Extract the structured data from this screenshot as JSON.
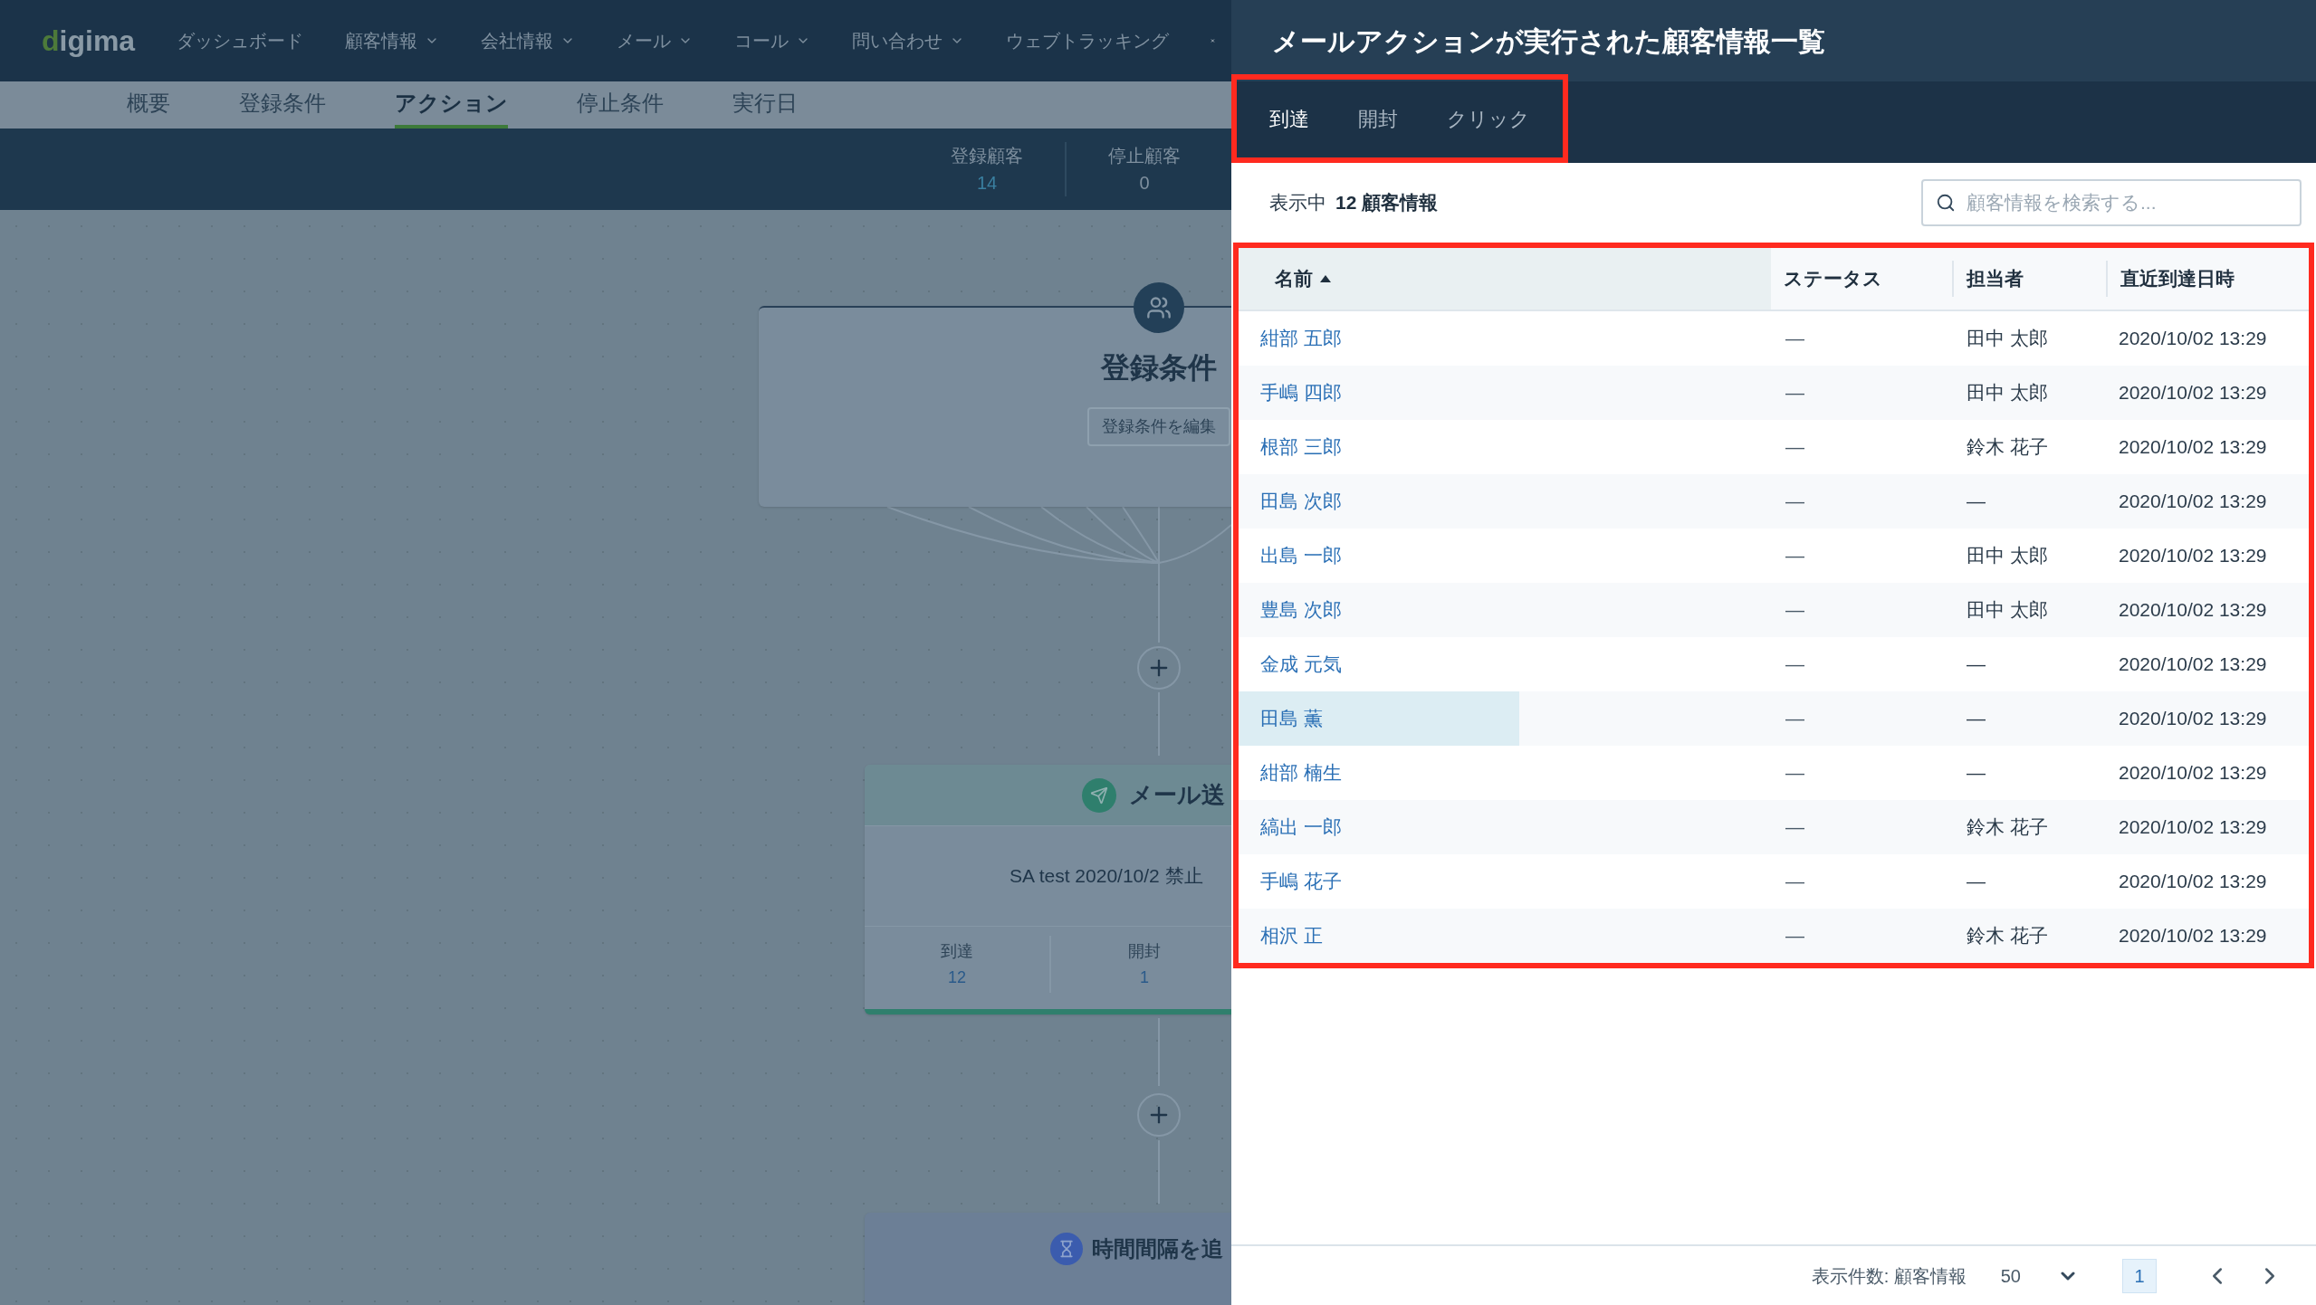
{
  "nav": {
    "logo": "digima",
    "items": [
      {
        "label": "ダッシュボード",
        "dropdown": false
      },
      {
        "label": "顧客情報",
        "dropdown": true
      },
      {
        "label": "会社情報",
        "dropdown": true
      },
      {
        "label": "メール",
        "dropdown": true
      },
      {
        "label": "コール",
        "dropdown": true
      },
      {
        "label": "問い合わせ",
        "dropdown": true
      },
      {
        "label": "ウェブトラッキング",
        "dropdown": false
      }
    ]
  },
  "sub_tabs": [
    {
      "label": "概要",
      "selected": false
    },
    {
      "label": "登録条件",
      "selected": false
    },
    {
      "label": "アクション",
      "selected": true
    },
    {
      "label": "停止条件",
      "selected": false
    },
    {
      "label": "実行日",
      "selected": false
    }
  ],
  "stats": [
    {
      "label": "登録顧客",
      "value": "14",
      "link": true
    },
    {
      "label": "停止顧客",
      "value": "0",
      "link": false
    }
  ],
  "canvas": {
    "entry_node": {
      "title": "登録条件",
      "button": "登録条件を編集"
    },
    "mail_node": {
      "title": "メール送",
      "subject": "SA test 2020/10/2 禁止",
      "stats": [
        {
          "label": "到達",
          "value": "12"
        },
        {
          "label": "開封",
          "value": "1"
        }
      ]
    },
    "wait_node": {
      "title": "時間間隔を追"
    }
  },
  "panel": {
    "title": "メールアクションが実行された顧客情報一覧",
    "tab_bar": {
      "outlined": true,
      "tabs": [
        {
          "label": "到達",
          "selected": true
        },
        {
          "label": "開封",
          "selected": false
        },
        {
          "label": "クリック",
          "selected": false
        }
      ]
    },
    "count_label": "表示中",
    "count": "12 顧客情報",
    "search": {
      "placeholder": "顧客情報を検索する..."
    },
    "table": {
      "outlined": true,
      "columns": [
        {
          "label": "名前",
          "sorted": true
        },
        {
          "label": "ステータス",
          "sorted": false
        },
        {
          "label": "担当者",
          "sorted": false
        },
        {
          "label": "直近到達日時",
          "sorted": false
        }
      ],
      "rows": [
        {
          "name": "紺部 五郎",
          "status": "—",
          "owner": "田中 太郎",
          "date": "2020/10/02 13:29",
          "hovered": false
        },
        {
          "name": "手嶋 四郎",
          "status": "—",
          "owner": "田中 太郎",
          "date": "2020/10/02 13:29",
          "hovered": false
        },
        {
          "name": "根部 三郎",
          "status": "—",
          "owner": "鈴木 花子",
          "date": "2020/10/02 13:29",
          "hovered": false
        },
        {
          "name": "田島 次郎",
          "status": "—",
          "owner": "—",
          "date": "2020/10/02 13:29",
          "hovered": false
        },
        {
          "name": "出島 一郎",
          "status": "—",
          "owner": "田中 太郎",
          "date": "2020/10/02 13:29",
          "hovered": false
        },
        {
          "name": "豊島 次郎",
          "status": "—",
          "owner": "田中 太郎",
          "date": "2020/10/02 13:29",
          "hovered": false
        },
        {
          "name": "金成 元気",
          "status": "—",
          "owner": "—",
          "date": "2020/10/02 13:29",
          "hovered": false
        },
        {
          "name": "田島 薫",
          "status": "—",
          "owner": "—",
          "date": "2020/10/02 13:29",
          "hovered": true
        },
        {
          "name": "紺部 楠生",
          "status": "—",
          "owner": "—",
          "date": "2020/10/02 13:29",
          "hovered": false
        },
        {
          "name": "縞出 一郎",
          "status": "—",
          "owner": "鈴木 花子",
          "date": "2020/10/02 13:29",
          "hovered": false
        },
        {
          "name": "手嶋 花子",
          "status": "—",
          "owner": "—",
          "date": "2020/10/02 13:29",
          "hovered": false
        },
        {
          "name": "相沢 正",
          "status": "—",
          "owner": "鈴木 花子",
          "date": "2020/10/02 13:29",
          "hovered": false
        }
      ]
    },
    "footer": {
      "per_page_label": "表示件数: 顧客情報",
      "per_page": "50",
      "page": "1"
    }
  }
}
